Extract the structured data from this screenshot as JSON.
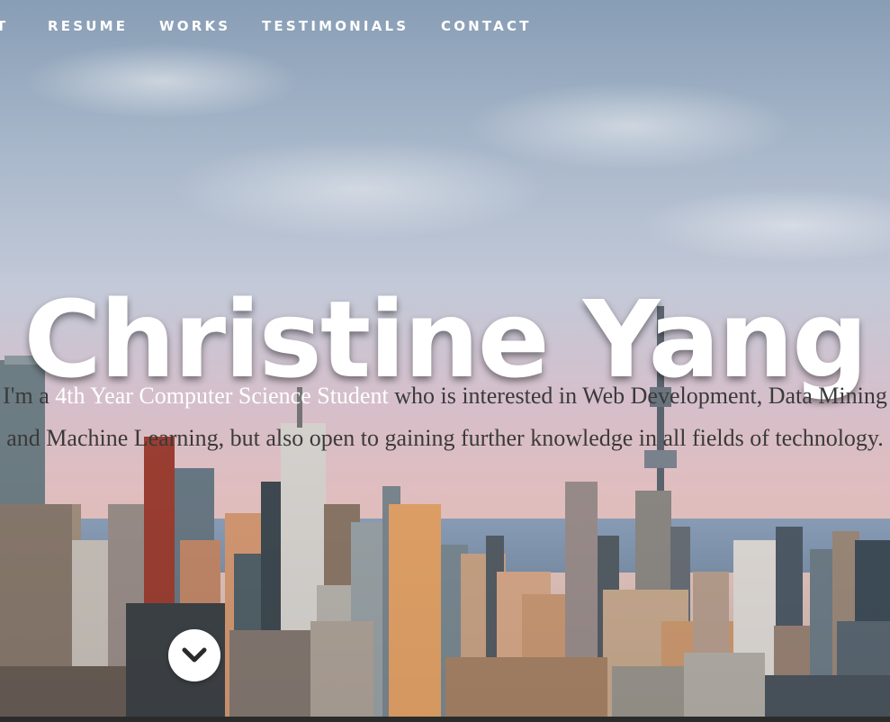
{
  "nav": {
    "items": [
      "T",
      "RESUME",
      "WORKS",
      "TESTIMONIALS",
      "CONTACT"
    ]
  },
  "hero": {
    "name": "Christine Yang",
    "tagline_prefix": "I'm a ",
    "tagline_highlight": "4th Year Computer Science Student",
    "tagline_suffix": " who is interested in Web Development, Data Mining and Machine Learning, but also open to gaining further knowledge in all fields of technology."
  },
  "scroll_button": {
    "icon": "chevron-down-icon"
  },
  "colors": {
    "nav_text": "#ffffff",
    "title_text": "#ffffff",
    "tagline_text": "#3a3a3a",
    "tagline_highlight": "#ffffff"
  }
}
